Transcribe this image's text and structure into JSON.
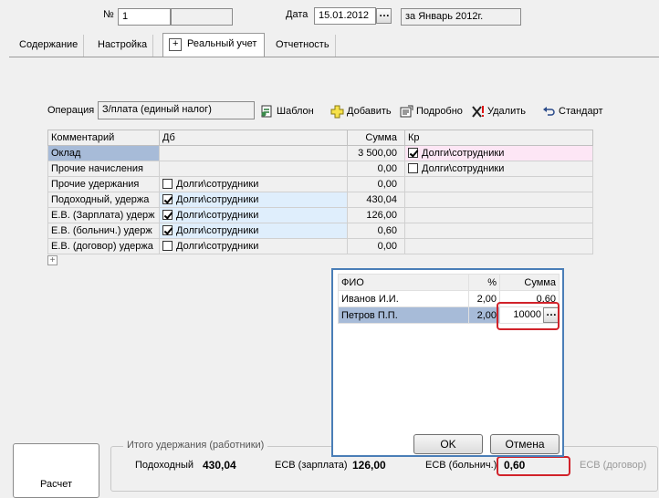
{
  "header": {
    "number_label": "№",
    "number_value": "1",
    "date_label": "Дата",
    "date_value": "15.01.2012",
    "period": "за Январь 2012г."
  },
  "tabs": [
    {
      "label": "Содержание"
    },
    {
      "label": "Настройка"
    },
    {
      "label": "Реальный учет",
      "active": true
    },
    {
      "label": "Отчетность"
    }
  ],
  "operation": {
    "label": "Операция",
    "value": "З/плата (единый налог)"
  },
  "toolbar": {
    "template": "Шаблон",
    "add": "Добавить",
    "details": "Подробно",
    "delete": "Удалить",
    "standard": "Стандарт"
  },
  "grid": {
    "headers": {
      "comment": "Комментарий",
      "db": "Дб",
      "sum": "Сумма",
      "kr": "Кр"
    },
    "rows": [
      {
        "comment": "Оклад",
        "db": "",
        "db_checked": null,
        "sum": "3 500,00",
        "kr": "Долги\\сотрудники",
        "kr_checked": true
      },
      {
        "comment": "Прочие начисления",
        "db": "",
        "db_checked": null,
        "sum": "0,00",
        "kr": "Долги\\сотрудники",
        "kr_checked": false
      },
      {
        "comment": "Прочие удержания",
        "db": "Долги\\сотрудники",
        "db_checked": false,
        "sum": "0,00",
        "kr": "",
        "kr_checked": null
      },
      {
        "comment": "Подоходный, удержа",
        "db": "Долги\\сотрудники",
        "db_checked": true,
        "sum": "430,04",
        "kr": "",
        "kr_checked": null
      },
      {
        "comment": "Е.В. (Зарплата) удерж",
        "db": "Долги\\сотрудники",
        "db_checked": true,
        "sum": "126,00",
        "kr": "",
        "kr_checked": null
      },
      {
        "comment": "Е.В. (больнич.) удерж",
        "db": "Долги\\сотрудники",
        "db_checked": true,
        "sum": "0,60",
        "kr": "",
        "kr_checked": null
      },
      {
        "comment": "Е.В. (договор) удержа",
        "db": "Долги\\сотрудники",
        "db_checked": false,
        "sum": "0,00",
        "kr": "",
        "kr_checked": null
      }
    ],
    "expand_glyph": "+"
  },
  "popup": {
    "headers": {
      "name": "ФИО",
      "pct": "%",
      "sum": "Сумма"
    },
    "rows": [
      {
        "name": "Иванов И.И.",
        "pct": "2,00",
        "sum": "0,60"
      },
      {
        "name": "Петров П.П.",
        "pct": "2,00",
        "sum": "10000"
      }
    ],
    "ok": "OK",
    "cancel": "Отмена"
  },
  "totals": {
    "group_title": "Итого удержания (работники)",
    "income_label": "Подоходный",
    "income_value": "430,04",
    "esv_salary_label": "ЕСВ (зарплата)",
    "esv_salary_value": "126,00",
    "esv_sick_label": "ЕСВ (больнич.)",
    "esv_sick_value": "0,60",
    "esv_contract_label": "ЕСВ (договор)"
  },
  "bottom_button": "Расчет",
  "colors": {
    "accent_border": "#4a7eb7",
    "highlight": "#d1222a",
    "selection": "#a7bbd8"
  }
}
